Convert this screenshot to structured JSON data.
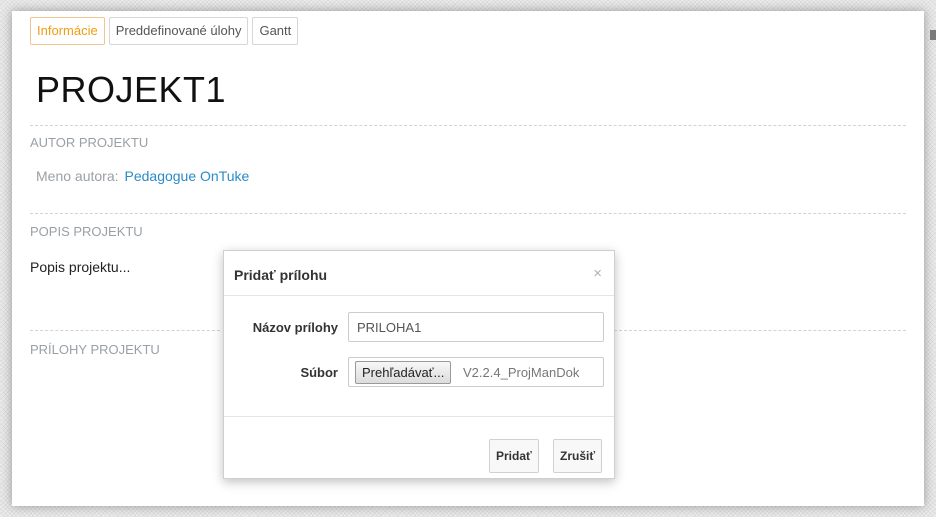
{
  "tabs": [
    {
      "label": "Informácie",
      "active": true
    },
    {
      "label": "Preddefinované úlohy",
      "active": false
    },
    {
      "label": "Gantt",
      "active": false
    }
  ],
  "page_title": "PROJEKT1",
  "sections": {
    "author": {
      "heading": "AUTOR PROJEKTU",
      "key": "Meno autora:",
      "value": "Pedagogue OnTuke"
    },
    "description": {
      "heading": "POPIS PROJEKTU",
      "text": "Popis projektu..."
    },
    "attachments": {
      "heading": "PRÍLOHY PROJEKTU"
    }
  },
  "modal": {
    "title": "Pridať prílohu",
    "close_icon": "×",
    "name_label": "Názov prílohy",
    "name_value": "PRILOHA1",
    "file_label": "Súbor",
    "browse_label": "Prehľadávať...",
    "file_name": "V2.2.4_ProjManDok",
    "add_label": "Pridať",
    "cancel_label": "Zrušiť"
  },
  "colors": {
    "accent": "#f39c12",
    "link": "#2a8bc6",
    "muted": "#9aa0a6"
  }
}
